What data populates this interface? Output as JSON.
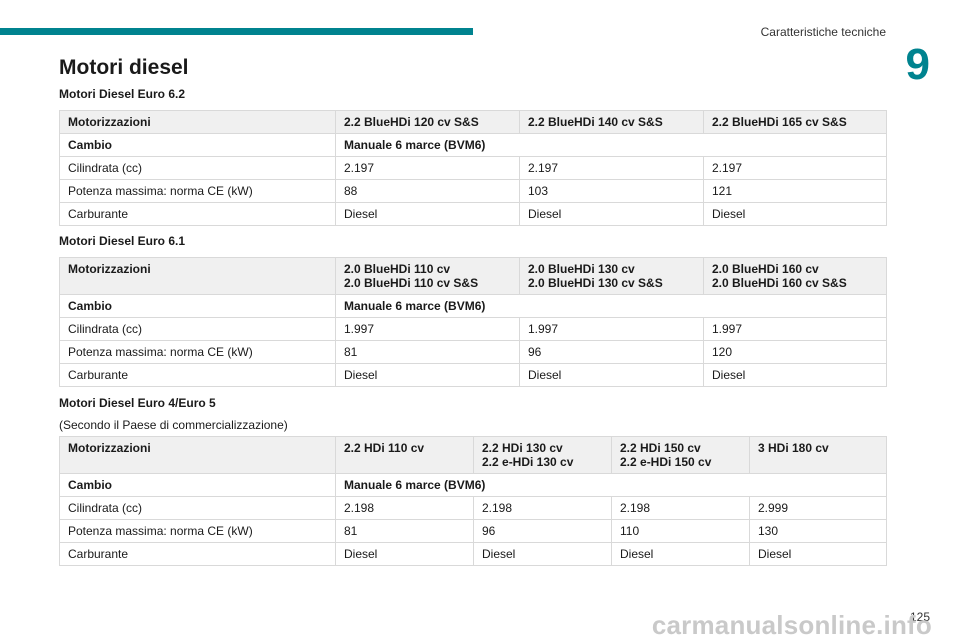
{
  "header": {
    "section": "Caratteristiche tecniche",
    "chapter": "9"
  },
  "page_title": "Motori diesel",
  "tables": [
    {
      "subtitle": "Motori Diesel Euro 6.2",
      "note": "",
      "rows": {
        "motorizzazioni": {
          "label": "Motorizzazioni",
          "values": [
            [
              "2.2 BlueHDi 120 cv S&S"
            ],
            [
              "2.2 BlueHDi 140 cv S&S"
            ],
            [
              "2.2 BlueHDi 165 cv S&S"
            ]
          ]
        },
        "cambio": {
          "label": "Cambio",
          "value": "Manuale 6 marce (BVM6)"
        },
        "cilindrata": {
          "label": "Cilindrata (cc)",
          "values": [
            "2.197",
            "2.197",
            "2.197"
          ]
        },
        "potenza": {
          "label": "Potenza massima: norma CE (kW)",
          "values": [
            "88",
            "103",
            "121"
          ]
        },
        "carburante": {
          "label": "Carburante",
          "values": [
            "Diesel",
            "Diesel",
            "Diesel"
          ]
        }
      }
    },
    {
      "subtitle": "Motori Diesel Euro 6.1",
      "note": "",
      "rows": {
        "motorizzazioni": {
          "label": "Motorizzazioni",
          "values": [
            [
              "2.0 BlueHDi 110 cv",
              "2.0 BlueHDi 110 cv S&S"
            ],
            [
              "2.0 BlueHDi 130 cv",
              "2.0 BlueHDi 130 cv S&S"
            ],
            [
              "2.0 BlueHDi 160 cv",
              "2.0 BlueHDi 160 cv S&S"
            ]
          ]
        },
        "cambio": {
          "label": "Cambio",
          "value": "Manuale 6 marce (BVM6)"
        },
        "cilindrata": {
          "label": "Cilindrata (cc)",
          "values": [
            "1.997",
            "1.997",
            "1.997"
          ]
        },
        "potenza": {
          "label": "Potenza massima: norma CE (kW)",
          "values": [
            "81",
            "96",
            "120"
          ]
        },
        "carburante": {
          "label": "Carburante",
          "values": [
            "Diesel",
            "Diesel",
            "Diesel"
          ]
        }
      }
    },
    {
      "subtitle": "Motori Diesel Euro 4/Euro 5",
      "note": "(Secondo il Paese di commercializzazione)",
      "rows": {
        "motorizzazioni": {
          "label": "Motorizzazioni",
          "values": [
            [
              "2.2 HDi 110 cv"
            ],
            [
              "2.2 HDi 130 cv",
              "2.2 e-HDi 130 cv"
            ],
            [
              "2.2 HDi 150 cv",
              "2.2 e-HDi 150 cv"
            ],
            [
              "3 HDi 180 cv"
            ]
          ]
        },
        "cambio": {
          "label": "Cambio",
          "value": "Manuale 6 marce (BVM6)"
        },
        "cilindrata": {
          "label": "Cilindrata (cc)",
          "values": [
            "2.198",
            "2.198",
            "2.198",
            "2.999"
          ]
        },
        "potenza": {
          "label": "Potenza massima: norma CE (kW)",
          "values": [
            "81",
            "96",
            "110",
            "130"
          ]
        },
        "carburante": {
          "label": "Carburante",
          "values": [
            "Diesel",
            "Diesel",
            "Diesel",
            "Diesel"
          ]
        }
      }
    }
  ],
  "footer": {
    "page_number": "125",
    "watermark": "carmanualsonline.info"
  },
  "colors": {
    "accent": "#00838f",
    "header_row_bg": "#f0f0f0",
    "border": "#d9d9d9"
  }
}
